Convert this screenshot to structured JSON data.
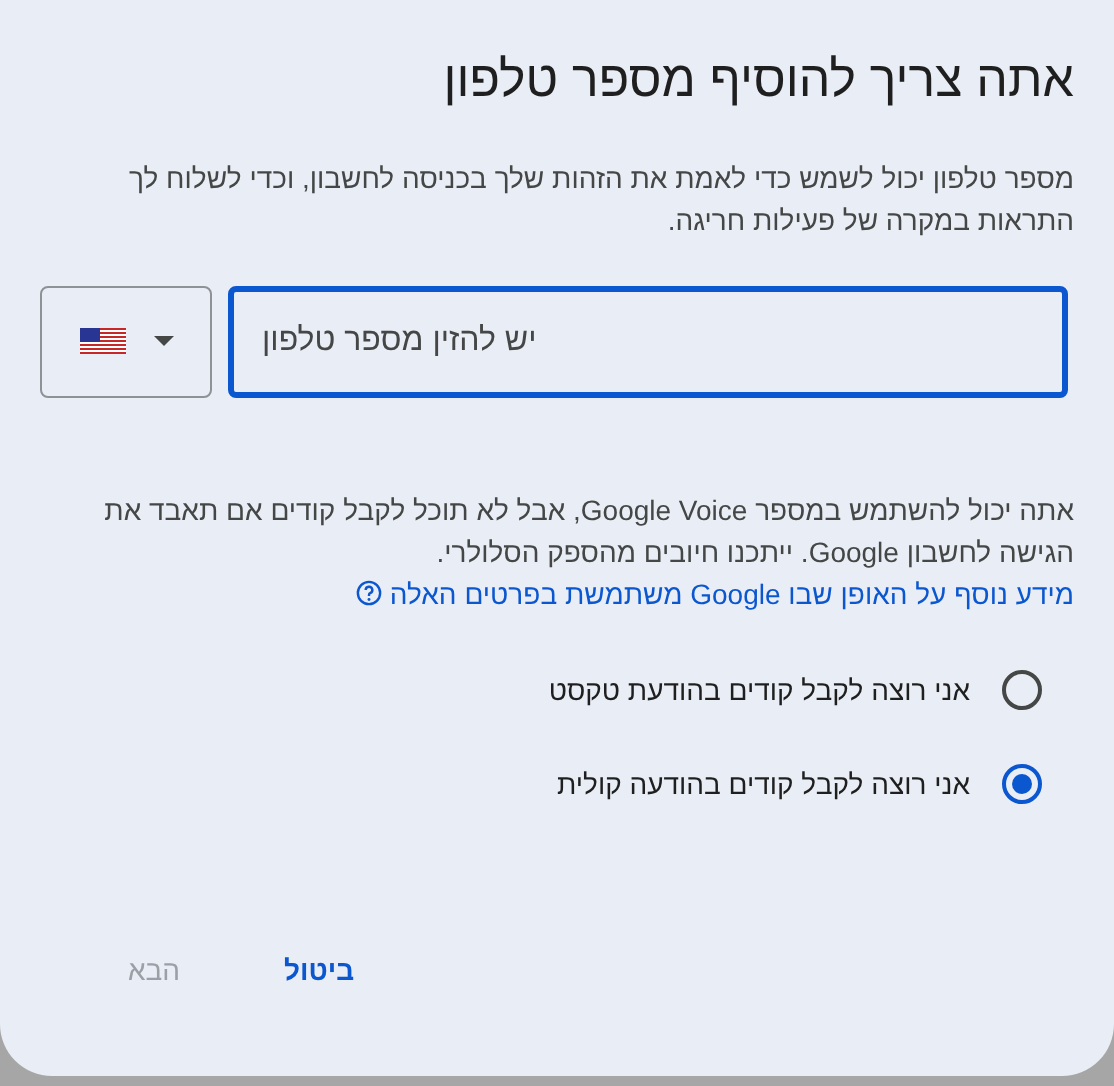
{
  "dialog": {
    "title": "אתה צריך להוסיף מספר טלפון",
    "description": "מספר טלפון יכול לשמש כדי לאמת את הזהות שלך בכניסה לחשבון, וכדי לשלוח לך התראות במקרה של פעילות חריגה.",
    "phone": {
      "placeholder": "יש להזין מספר טלפון",
      "focused": true
    },
    "note": {
      "text": "אתה יכול להשתמש במספר Google Voice, אבל לא תוכל לקבל קודים אם תאבד את הגישה לחשבון Google. ייתכנו חיובים מהספק הסלולרי.",
      "link": "מידע נוסף על האופן שבו Google משתמשת בפרטים האלה"
    },
    "options": [
      {
        "label": "אני רוצה לקבל קודים בהודעת טקסט",
        "selected": false
      },
      {
        "label": "אני רוצה לקבל קודים בהודעה קולית",
        "selected": true
      }
    ],
    "buttons": [
      {
        "label": "ביטול",
        "disabled": false
      },
      {
        "label": "הבא",
        "disabled": true
      }
    ]
  }
}
